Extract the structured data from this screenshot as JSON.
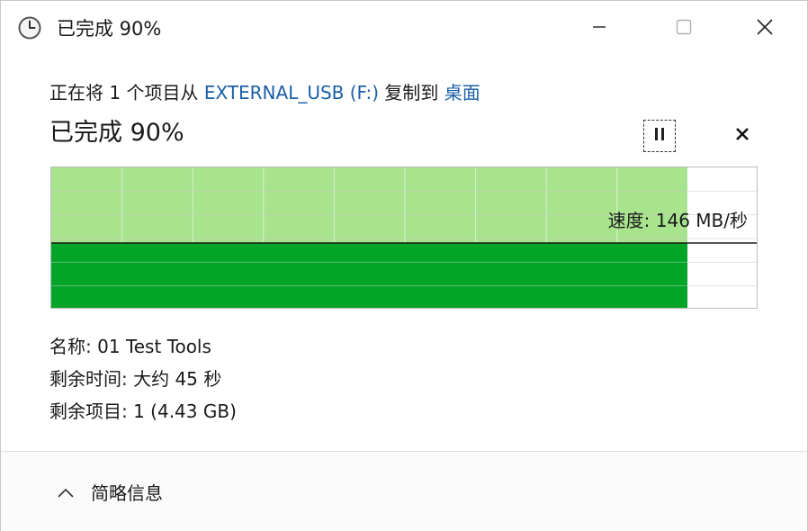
{
  "window": {
    "title": "已完成 90%"
  },
  "header": {
    "prefix": "正在将 1 个项目从",
    "source": "EXTERNAL_USB (F:)",
    "middle": "复制到",
    "destination": "桌面",
    "status": "已完成 90%"
  },
  "progress": {
    "percent": 90,
    "speed_label": "速度: 146 MB/秒",
    "speed_value_mb_s": 146
  },
  "details": {
    "name": "名称: 01 Test Tools",
    "time_remaining": "剩余时间: 大约 45 秒",
    "items_remaining": "剩余项目: 1 (4.43 GB)"
  },
  "footer": {
    "less_details_label": "简略信息"
  },
  "colors": {
    "progress_fill_light": "#a8e38e",
    "progress_fill_dark": "#00a427",
    "link": "#1a5fa8"
  },
  "icons": {
    "title": "clock-icon",
    "minimize": "minimize-icon",
    "maximize": "maximize-icon",
    "close": "close-icon",
    "pause": "pause-icon",
    "cancel": "cancel-icon",
    "chevron": "chevron-up-icon"
  }
}
